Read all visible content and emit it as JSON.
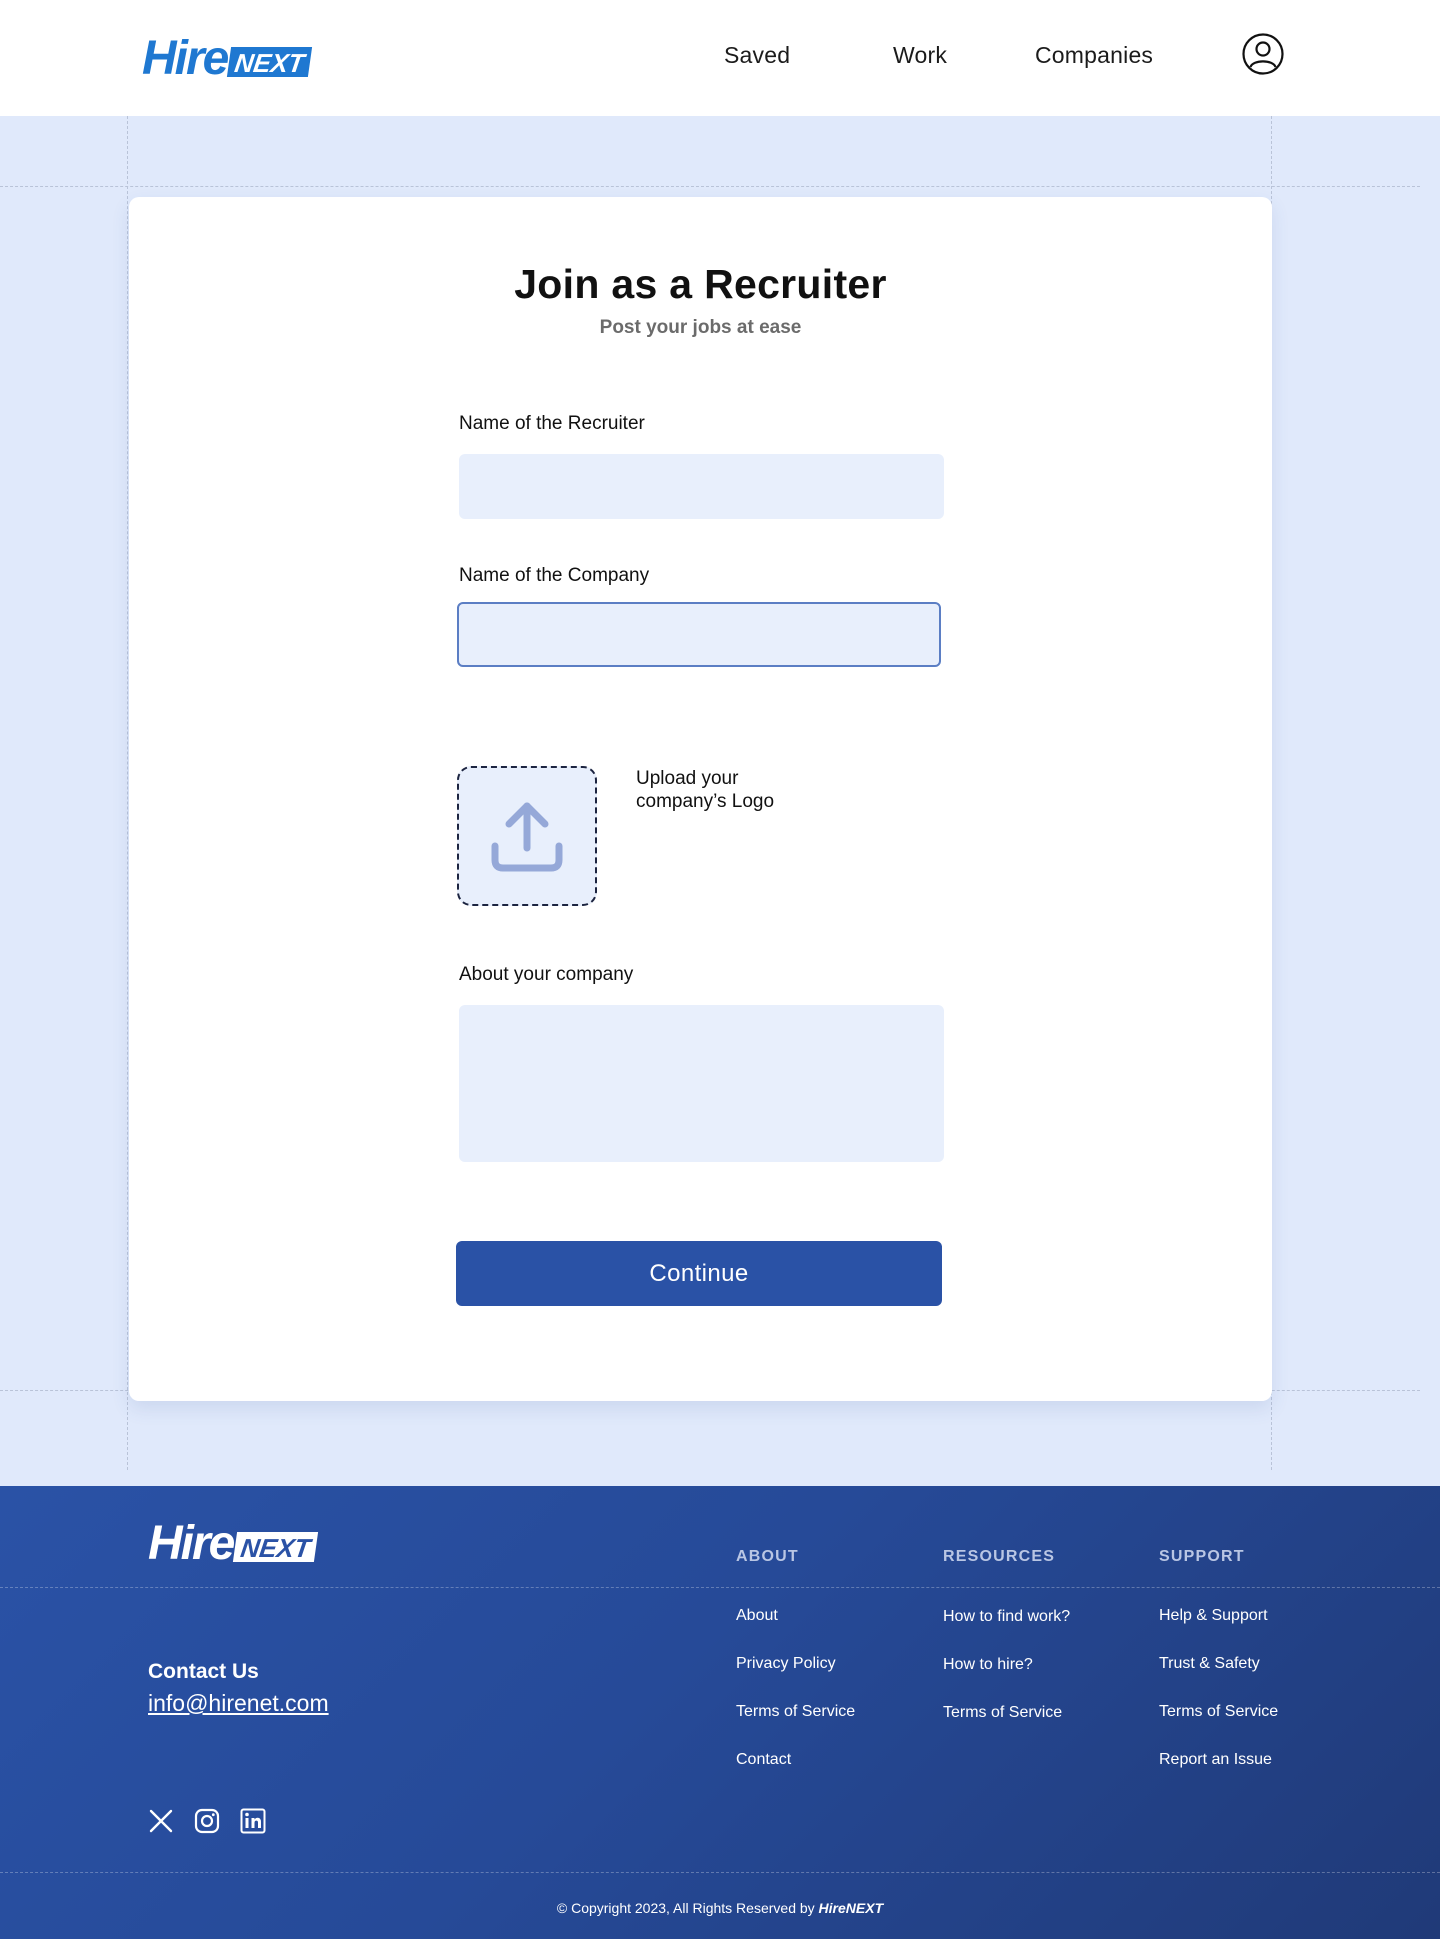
{
  "header": {
    "logo": {
      "hire": "Hire",
      "next": "NEXT"
    },
    "nav": [
      {
        "label": "Saved"
      },
      {
        "label": "Work"
      },
      {
        "label": "Companies"
      }
    ],
    "profile_icon": "user-circle-icon"
  },
  "form": {
    "title": "Join as a Recruiter",
    "subtitle": "Post your jobs at ease",
    "recruiter_label": "Name of the Recruiter",
    "recruiter_value": "",
    "company_label": "Name of the Company",
    "company_value": "",
    "upload_icon": "upload-icon",
    "upload_label_line1": "Upload your",
    "upload_label_line2": "company’s Logo",
    "about_label": "About your company",
    "about_value": "",
    "continue_label": "Continue"
  },
  "footer": {
    "logo": {
      "hire": "Hire",
      "next": "NEXT"
    },
    "contact_title": "Contact Us",
    "contact_email": "info@hirenet.com",
    "social_icons": [
      "x-icon",
      "instagram-icon",
      "linkedin-icon"
    ],
    "columns": [
      {
        "heading": "ABOUT",
        "links": [
          "About",
          "Privacy Policy",
          "Terms of Service",
          "Contact"
        ]
      },
      {
        "heading": "RESOURCES",
        "links": [
          "How to find work?",
          "How to hire?",
          "Terms of Service"
        ]
      },
      {
        "heading": "SUPPORT",
        "links": [
          "Help & Support",
          "Trust & Safety",
          "Terms of Service",
          "Report an Issue"
        ]
      }
    ],
    "copyright_text": "© Copyright 2023, All Rights Reserved by",
    "copyright_brand": "HireNEXT"
  },
  "colors": {
    "brand_blue": "#1f78d1",
    "primary_button": "#2a52a6",
    "page_background": "#e0e9fb",
    "input_background": "#e8effc",
    "footer_background": "#264a98"
  }
}
